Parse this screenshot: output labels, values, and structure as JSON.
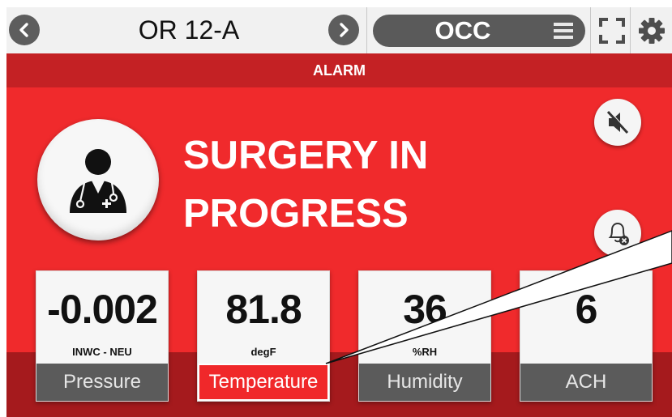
{
  "header": {
    "room": "OR 12-A",
    "mode": "OCC"
  },
  "alarm": {
    "banner": "ALARM",
    "status_line1": "SURGERY IN",
    "status_line2": "PROGRESS"
  },
  "tiles": [
    {
      "value": "-0.002",
      "unit": "INWC - NEU",
      "label": "Pressure",
      "alarm": false
    },
    {
      "value": "81.8",
      "unit": "degF",
      "label": "Temperature",
      "alarm": true
    },
    {
      "value": "36",
      "unit": "%RH",
      "label": "Humidity",
      "alarm": false
    },
    {
      "value": "6",
      "unit": "",
      "label": "ACH",
      "alarm": false
    }
  ],
  "colors": {
    "alarm_red": "#f02a2c",
    "banner_red": "#c42124",
    "tile_label_gray": "#5b5b5b"
  },
  "icons": [
    "chevron-left-icon",
    "chevron-right-icon",
    "menu-icon",
    "fullscreen-icon",
    "gear-icon",
    "doctor-icon",
    "mute-icon",
    "bell-clear-icon"
  ]
}
